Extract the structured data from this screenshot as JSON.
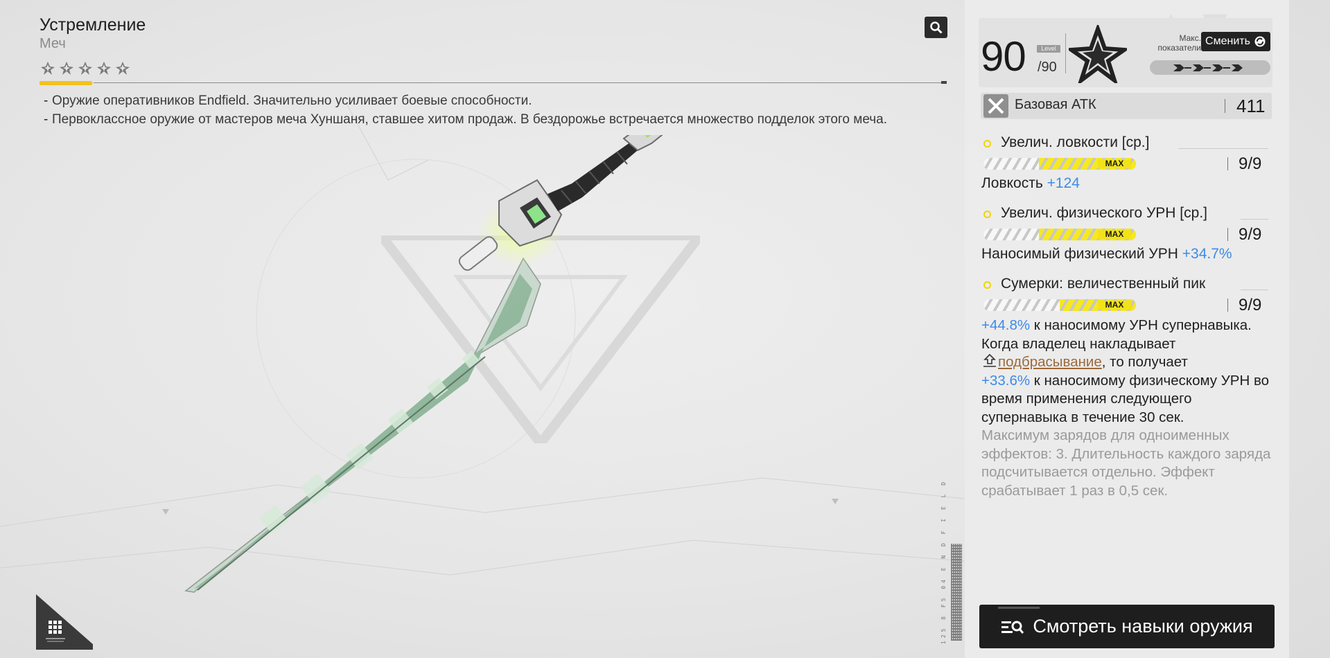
{
  "weapon": {
    "name": "Устремление",
    "type": "Меч",
    "stars": 5,
    "description": [
      "Оружие оперативников Endfield. Значительно усиливает боевые способности.",
      "Первоклассное оружие от мастеров меча Хуншаня, ставшее хитом продаж. В бездорожье встречается множество подделок этого меча."
    ]
  },
  "panel": {
    "level": "90",
    "level_max": "/90",
    "level_tag": "Level",
    "max_stats_label_1": "Макс.",
    "max_stats_label_2": "показатели",
    "switch_button": "Сменить",
    "base_atk_label": "Базовая АТК",
    "base_atk_value": "411",
    "skills": [
      {
        "name": "Увелич. ловкости [ср.]",
        "max": "MAX",
        "count": "9/9",
        "effect_label": "Ловкость",
        "effect_value": "+124"
      },
      {
        "name": "Увелич. физического УРН [ср.]",
        "max": "MAX",
        "count": "9/9",
        "effect_label": "Наносимый физический УРН",
        "effect_value": "+34.7%"
      },
      {
        "name": "Сумерки: величественный пик",
        "max": "MAX",
        "count": "9/9"
      }
    ],
    "skill3_effect": {
      "value1": "+44.8%",
      "text1": " к наносимому УРН суперн­авыка.",
      "text2": "Когда владелец накладывает",
      "link": "подбрасывание",
      "text3": ", то получает",
      "value2": "+33.6%",
      "text4": " к наносимому физическому УРН во время применения следующего супернавыка в течение 30 сек.",
      "muted": "Максимум зарядов для одноименных эффектов: 3. Длительность каждого заряда подсчитывается отдельно. Эффект срабатывает 1 раз в 0,5 сек."
    },
    "view_skills_button": "Смотреть навыки оружия"
  },
  "side_code": "125 8 F5 04 E N D F I E L D",
  "colors": {
    "rarity": "#f3c21b",
    "max_badge": "#f1e219",
    "stat_blue": "#3d8be8",
    "link_brown": "#9b6a3a",
    "button_dark": "#1e1e1e"
  },
  "icons": [
    "star-rarity-icon",
    "search-icon",
    "pentagram-emblem-icon",
    "refresh-icon",
    "crossed-swords-icon",
    "launch-icon",
    "skills-list-icon",
    "grid-icon"
  ]
}
